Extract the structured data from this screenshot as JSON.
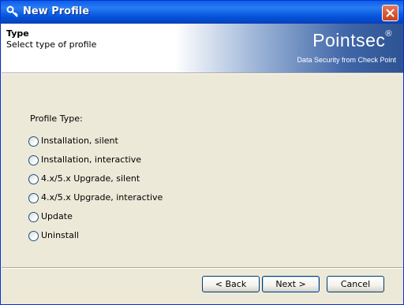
{
  "window": {
    "title": "New Profile"
  },
  "header": {
    "title": "Type",
    "subtitle": "Select type of profile",
    "brand": "Pointsec",
    "brand_mark": "®",
    "tagline": "Data Security from Check Point"
  },
  "form": {
    "profile_type_label": "Profile Type:",
    "options": [
      {
        "label": "Installation, silent",
        "selected": false
      },
      {
        "label": "Installation, interactive",
        "selected": false
      },
      {
        "label": "4.x/5.x Upgrade, silent",
        "selected": false
      },
      {
        "label": "4.x/5.x Upgrade, interactive",
        "selected": false
      },
      {
        "label": "Update",
        "selected": false
      },
      {
        "label": "Uninstall",
        "selected": false
      }
    ]
  },
  "buttons": {
    "back": "< Back",
    "next": "Next >",
    "cancel": "Cancel"
  },
  "colors": {
    "titlebar": "#0a5fe8",
    "dialog_bg": "#ece9d8",
    "close_button": "#c8421f"
  }
}
